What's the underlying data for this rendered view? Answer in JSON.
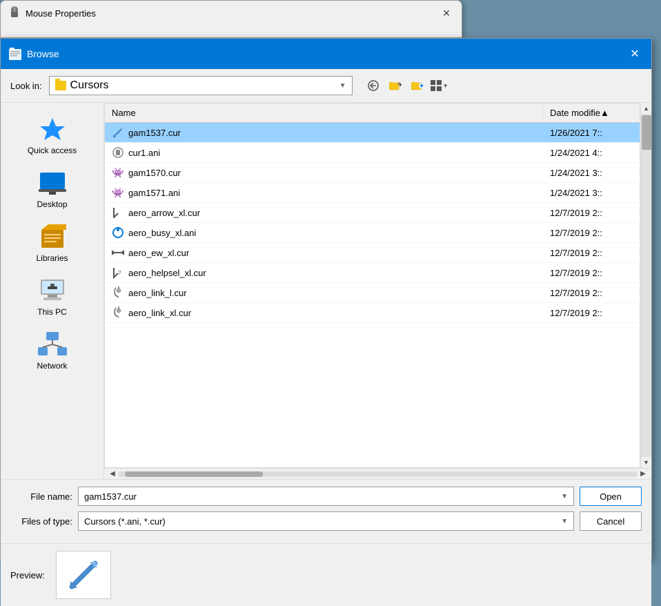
{
  "mouse_properties": {
    "title": "Mouse Properties",
    "close_label": "✕"
  },
  "browse_dialog": {
    "title": "Browse",
    "close_label": "✕",
    "toolbar": {
      "look_in_label": "Look in:",
      "current_folder": "Cursors",
      "back_icon": "🔙",
      "up_icon": "⬆",
      "new_folder_icon": "📁",
      "views_icon": "⊞"
    },
    "sidebar": {
      "items": [
        {
          "id": "quick-access",
          "label": "Quick access",
          "icon_type": "star"
        },
        {
          "id": "desktop",
          "label": "Desktop",
          "icon_type": "desktop"
        },
        {
          "id": "libraries",
          "label": "Libraries",
          "icon_type": "libraries"
        },
        {
          "id": "this-pc",
          "label": "This PC",
          "icon_type": "thispc"
        },
        {
          "id": "network",
          "label": "Network",
          "icon_type": "network"
        }
      ]
    },
    "file_list": {
      "header": {
        "name_label": "Name",
        "date_label": "Date modifie▲"
      },
      "files": [
        {
          "name": "gam1537.cur",
          "date": "1/26/2021 7::",
          "icon": "⚔",
          "selected": true,
          "icon_color": "#4488cc"
        },
        {
          "name": "cur1.ani",
          "date": "1/24/2021 4::",
          "icon": "🎮",
          "selected": false,
          "icon_color": "#888"
        },
        {
          "name": "gam1570.cur",
          "date": "1/24/2021 3::",
          "icon": "👾",
          "selected": false,
          "icon_color": "#cc0000"
        },
        {
          "name": "gam1571.ani",
          "date": "1/24/2021 3::",
          "icon": "👾",
          "selected": false,
          "icon_color": "#cc0000"
        },
        {
          "name": "aero_arrow_xl.cur",
          "date": "12/7/2019 2::",
          "icon": "↖",
          "selected": false,
          "icon_color": "#333"
        },
        {
          "name": "aero_busy_xl.ani",
          "date": "12/7/2019 2::",
          "icon": "◉",
          "selected": false,
          "icon_color": "#0078d7"
        },
        {
          "name": "aero_ew_xl.cur",
          "date": "12/7/2019 2::",
          "icon": "↔",
          "selected": false,
          "icon_color": "#555"
        },
        {
          "name": "aero_helpsel_xl.cur",
          "date": "12/7/2019 2::",
          "icon": "↖",
          "selected": false,
          "icon_color": "#555"
        },
        {
          "name": "aero_link_l.cur",
          "date": "12/7/2019 2::",
          "icon": "☞",
          "selected": false,
          "icon_color": "#666"
        },
        {
          "name": "aero_link_xl.cur",
          "date": "12/7/2019 2::",
          "icon": "☞",
          "selected": false,
          "icon_color": "#666"
        }
      ]
    },
    "bottom": {
      "file_name_label": "File name:",
      "file_name_value": "gam1537.cur",
      "file_type_label": "Files of type:",
      "file_type_value": "Cursors (*.ani, *.cur)",
      "open_label": "Open",
      "cancel_label": "Cancel"
    },
    "preview": {
      "label": "Preview:",
      "icon": "⚔"
    }
  }
}
